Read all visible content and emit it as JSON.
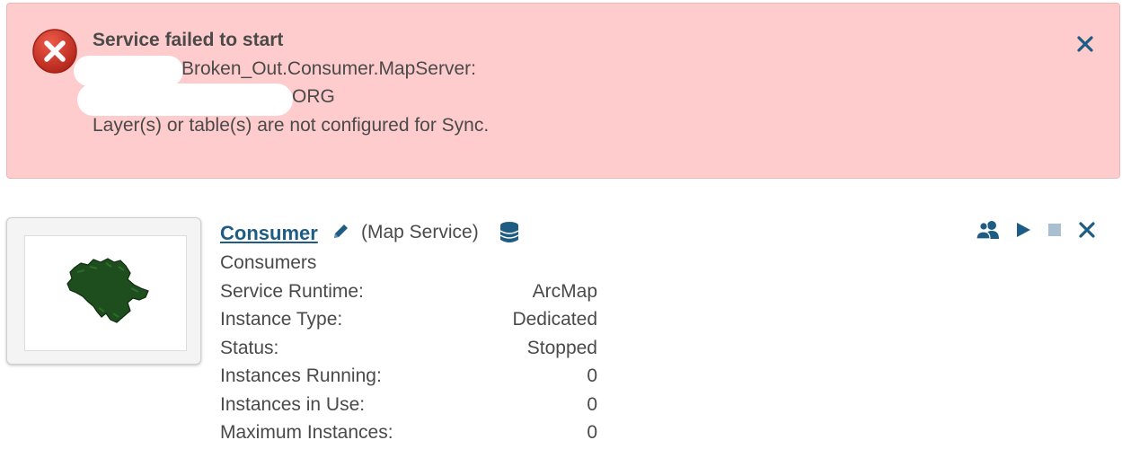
{
  "alert": {
    "title": "Service failed to start",
    "line1": "Broken_Out.Consumer.MapServer:",
    "line2": "ORG",
    "line3": "Layer(s) or table(s) are not configured for Sync.",
    "background_color": "#fecccc",
    "icon": "error-x-circle-icon",
    "close_icon": "close-icon"
  },
  "service": {
    "name": "Consumer",
    "type": "(Map Service)",
    "folder": "Consumers",
    "edit_icon": "pencil-icon",
    "datastore_icon": "database-icon",
    "link_color": "#1f5c84",
    "properties": [
      {
        "label": "Service Runtime:",
        "value": "ArcMap"
      },
      {
        "label": "Instance Type:",
        "value": "Dedicated"
      },
      {
        "label": "Status:",
        "value": "Stopped"
      },
      {
        "label": "Instances Running:",
        "value": "0"
      },
      {
        "label": "Instances in Use:",
        "value": "0"
      },
      {
        "label": "Maximum Instances:",
        "value": "0"
      }
    ]
  },
  "actions": [
    {
      "name": "permissions",
      "icon": "users-icon"
    },
    {
      "name": "start",
      "icon": "play-icon"
    },
    {
      "name": "stop",
      "icon": "stop-icon"
    },
    {
      "name": "delete",
      "icon": "close-icon"
    }
  ]
}
